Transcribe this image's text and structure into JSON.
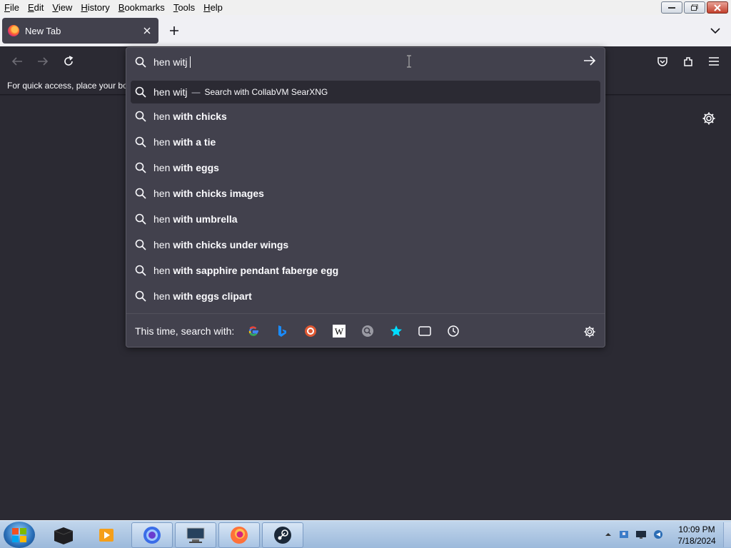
{
  "menu": [
    "File",
    "Edit",
    "View",
    "History",
    "Bookmarks",
    "Tools",
    "Help"
  ],
  "menu_accel": [
    "F",
    "E",
    "V",
    "H",
    "B",
    "T",
    "H"
  ],
  "tab": {
    "title": "New Tab"
  },
  "bookmarks_notice": "For quick access, place your bo",
  "urlbar": {
    "value": "hen witj",
    "results": [
      {
        "prefix": "hen witj",
        "bold": "",
        "dash": "—",
        "action": "Search with CollabVM SearXNG"
      },
      {
        "prefix": "hen",
        "bold": "with chicks"
      },
      {
        "prefix": "hen",
        "bold": "with a tie"
      },
      {
        "prefix": "hen",
        "bold": "with eggs"
      },
      {
        "prefix": "hen",
        "bold": "with chicks images"
      },
      {
        "prefix": "hen",
        "bold": "with umbrella"
      },
      {
        "prefix": "hen",
        "bold": "with chicks under wings"
      },
      {
        "prefix": "hen",
        "bold": "with sapphire pendant faberge egg"
      },
      {
        "prefix": "hen",
        "bold": "with eggs clipart"
      }
    ],
    "oneoff_label": "This time, search with:",
    "engines": [
      "google-icon",
      "bing-icon",
      "duckduckgo-icon",
      "wikipedia-icon",
      "searxng-icon",
      "bookmarks-star-icon",
      "tabs-icon",
      "history-clock-icon"
    ]
  },
  "clock": {
    "time": "10:09 PM",
    "date": "7/18/2024"
  },
  "colors": {
    "bg": "#2b2a33",
    "panel": "#42414d",
    "accent": "#00ddff"
  }
}
